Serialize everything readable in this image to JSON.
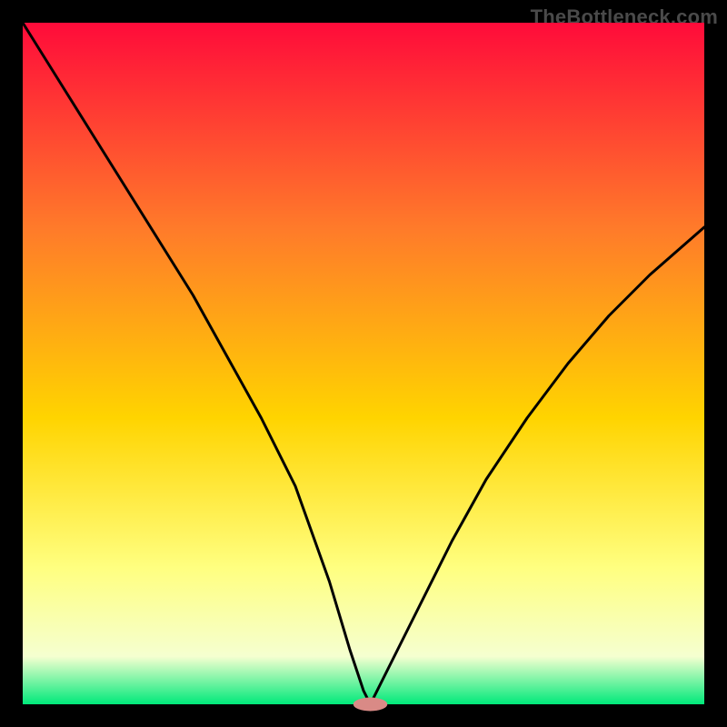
{
  "watermark": "TheBottleneck.com",
  "colors": {
    "gradient_top": "#ff0b3a",
    "gradient_mid_upper": "#ff7a2a",
    "gradient_mid": "#ffd400",
    "gradient_yellow_light": "#ffff80",
    "gradient_pale": "#f5ffd0",
    "gradient_green": "#00e97a",
    "curve": "#000000",
    "marker": "#d98a86",
    "frame": "#000000"
  },
  "layout": {
    "inner_x": 25,
    "inner_y": 25,
    "inner_w": 750,
    "inner_h": 750
  },
  "chart_data": {
    "type": "line",
    "title": "",
    "xlabel": "",
    "ylabel": "",
    "xlim": [
      0,
      100
    ],
    "ylim": [
      0,
      100
    ],
    "series": [
      {
        "name": "curve-left",
        "x": [
          0,
          5,
          10,
          15,
          20,
          25,
          30,
          35,
          40,
          45,
          48,
          50,
          51
        ],
        "y": [
          100,
          92,
          84,
          76,
          68,
          60,
          51,
          42,
          32,
          18,
          8,
          2,
          0
        ]
      },
      {
        "name": "curve-right",
        "x": [
          51,
          54,
          58,
          63,
          68,
          74,
          80,
          86,
          92,
          100
        ],
        "y": [
          0,
          6,
          14,
          24,
          33,
          42,
          50,
          57,
          63,
          70
        ]
      }
    ],
    "marker": {
      "x": 51,
      "y": 0,
      "rx": 2.5,
      "ry": 1
    }
  }
}
